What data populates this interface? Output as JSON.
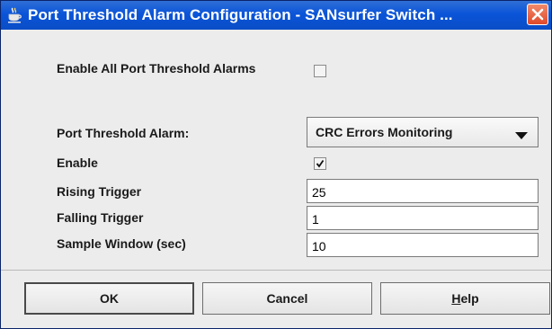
{
  "window": {
    "title": "Port Threshold Alarm Configuration - SANsurfer Switch ...",
    "icon": "java-coffee-icon",
    "close_icon": "close-icon",
    "accent_color": "#0a54d8",
    "close_color": "#e0492a"
  },
  "form": {
    "enable_all_label": "Enable All Port Threshold Alarms",
    "enable_all_checked": false,
    "alarm_label": "Port Threshold Alarm:",
    "alarm_selected": "CRC Errors Monitoring",
    "enable_label": "Enable",
    "enable_checked": true,
    "rising_label": "Rising Trigger",
    "rising_value": "25",
    "falling_label": "Falling Trigger",
    "falling_value": "1",
    "sample_label": "Sample Window (sec)",
    "sample_value": "10"
  },
  "buttons": {
    "ok": "OK",
    "cancel": "Cancel",
    "help_mnemonic": "H",
    "help_rest": "elp"
  }
}
